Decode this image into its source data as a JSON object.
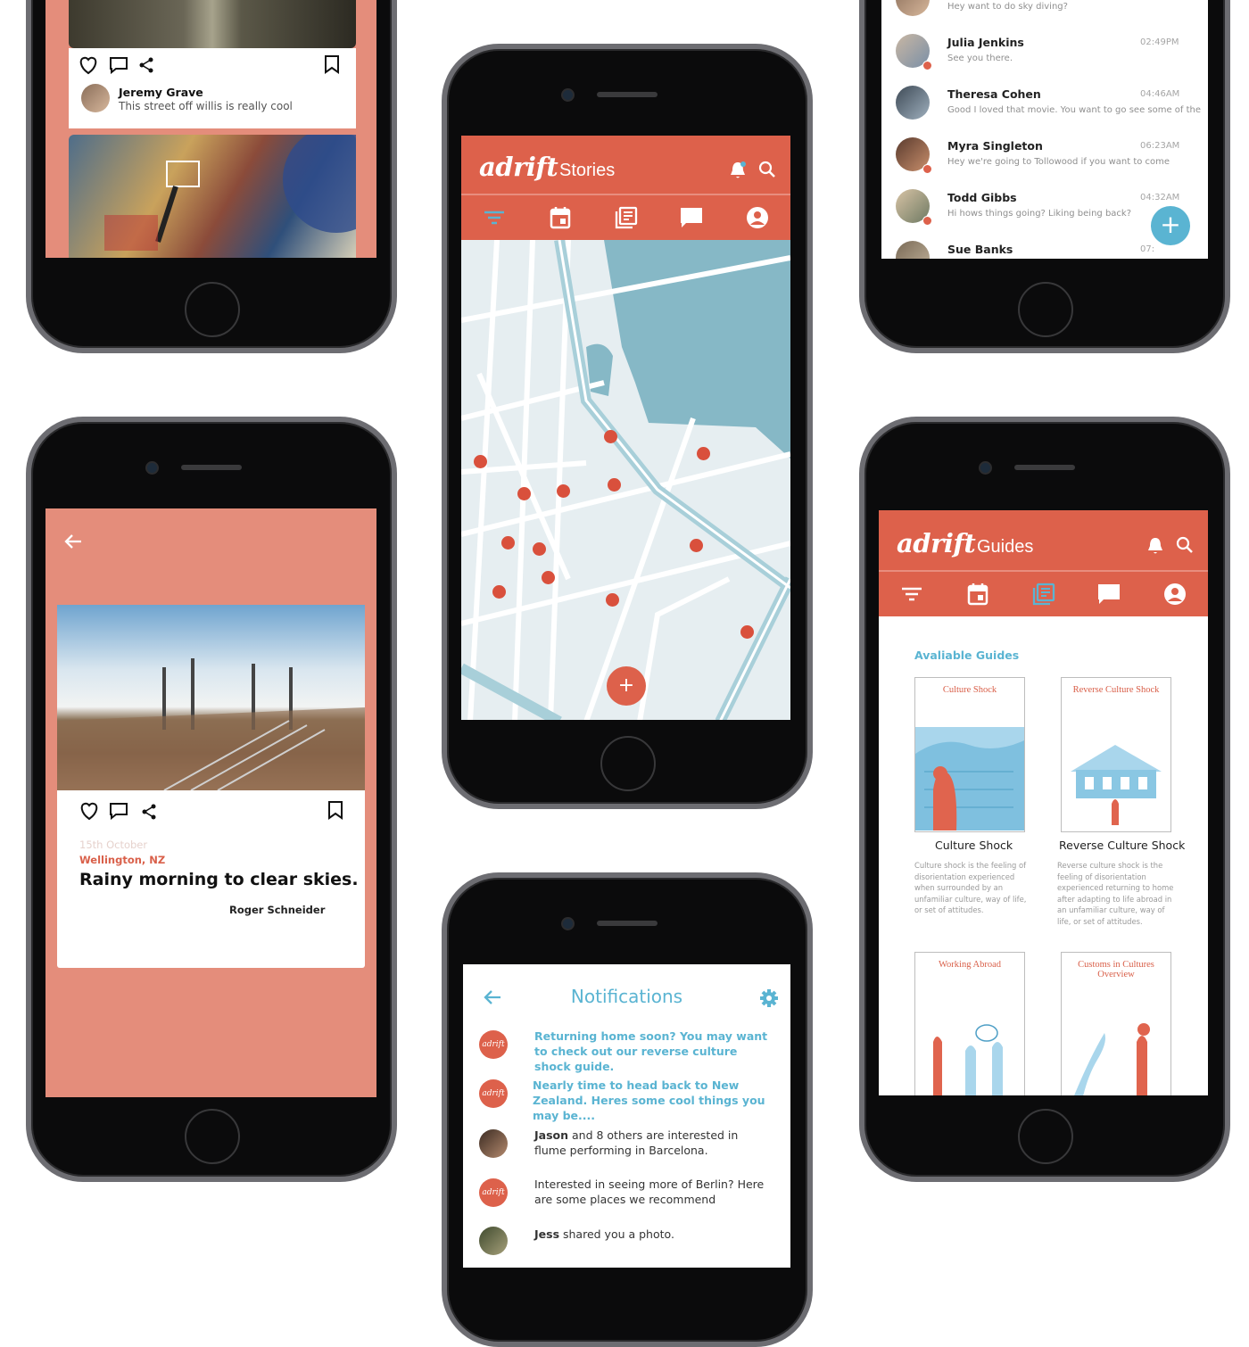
{
  "colors": {
    "accent": "#dd614b",
    "blue": "#5ab4d2",
    "salmon": "#e48d7b"
  },
  "feed": {
    "user_name": "Jeremy Grave",
    "caption": "This street off willis is really cool"
  },
  "messages": {
    "top_snippet": "Hey want to do sky diving?",
    "rows": [
      {
        "name": "Julia Jenkins",
        "time": "02:49PM",
        "text": "See you there."
      },
      {
        "name": "Theresa Cohen",
        "time": "04:46AM",
        "text": "Good I loved that movie. You want to go see some of the"
      },
      {
        "name": "Myra Singleton",
        "time": "06:23AM",
        "text": "Hey we're going to Tollowood if you want to come"
      },
      {
        "name": "Todd Gibbs",
        "time": "04:32AM",
        "text": "Hi hows things going? Liking being back?"
      },
      {
        "name": "Sue Banks",
        "time": "07:",
        "text": ""
      }
    ],
    "fab_label": "+"
  },
  "stories": {
    "logo": "adrift",
    "title": "Stories",
    "fab_label": "+"
  },
  "post": {
    "date": "15th October",
    "location": "Wellington, NZ",
    "title": "Rainy morning to clear skies.",
    "author": "Roger Schneider"
  },
  "notifications": {
    "title": "Notifications",
    "items": [
      {
        "avatar": "adrift",
        "text": "Returning home soon? You may want to check out our reverse culture shock guide.",
        "style": "blue"
      },
      {
        "avatar": "adrift",
        "text": "Nearly time to head back to New Zealand. Heres some cool things you may be....",
        "style": "blue"
      },
      {
        "avatar": "photo",
        "bold": "Jason",
        "text": " and 8 others are interested in flume performing in Barcelona.",
        "style": "plain"
      },
      {
        "avatar": "adrift",
        "text": "Interested in seeing more of Berlin? Here are some places we recommend",
        "style": "plain"
      },
      {
        "avatar": "photo",
        "bold": "Jess",
        "text": " shared you a photo.",
        "style": "plain"
      }
    ]
  },
  "guides": {
    "logo": "adrift",
    "title": "Guides",
    "section_label": "Avaliable Guides",
    "cards": [
      {
        "cover_title": "Culture Shock",
        "name": "Culture Shock",
        "desc": "Culture shock is the feeling of disorientation experienced when surrounded by an unfamiliar culture, way of life, or set of attitudes."
      },
      {
        "cover_title": "Reverse Culture Shock",
        "name": "Reverse Culture Shock",
        "desc": "Reverse culture shock is the feeling of disorientation experienced returning to home after adapting to life abroad in an unfamiliar culture, way of life, or set of attitudes."
      },
      {
        "cover_title": "Working Abroad",
        "name": "",
        "desc": ""
      },
      {
        "cover_title": "Customs in Cultures Overview",
        "name": "",
        "desc": ""
      }
    ]
  }
}
